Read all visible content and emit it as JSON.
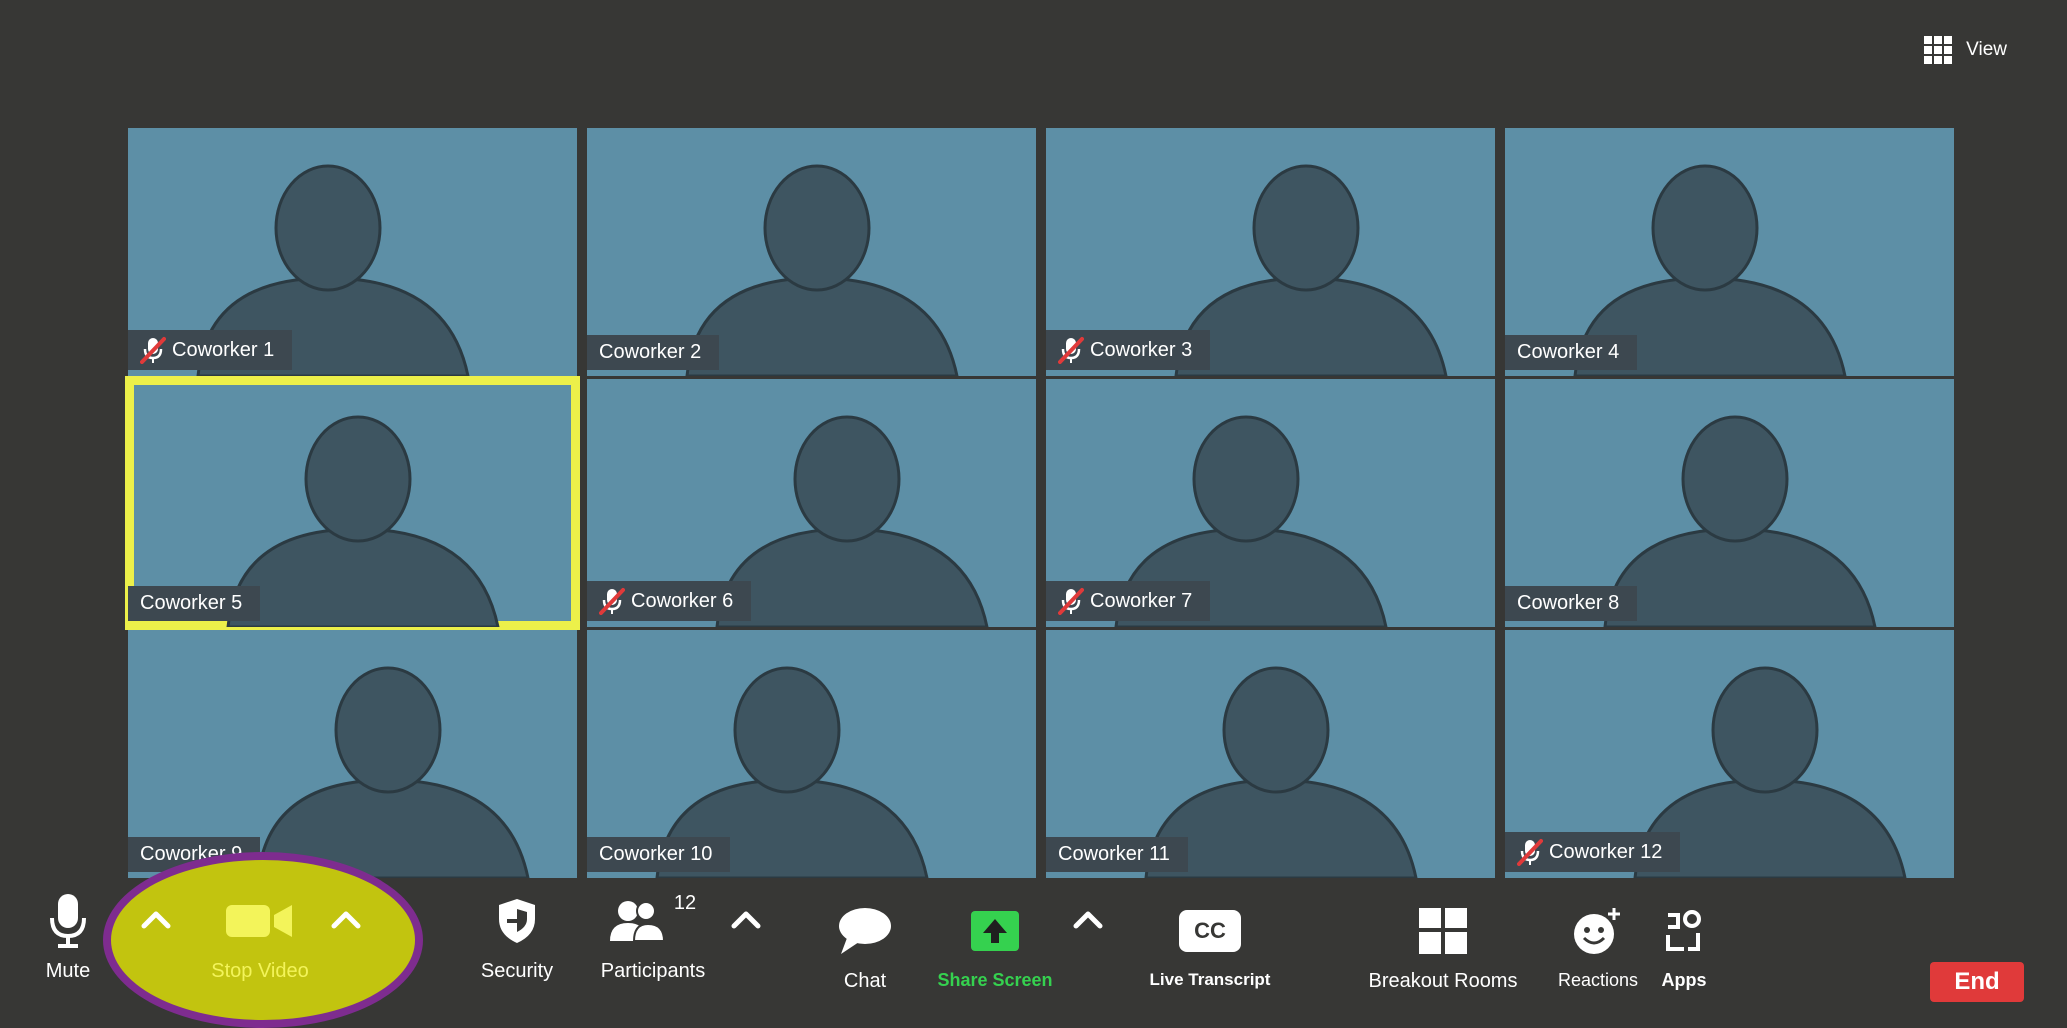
{
  "header": {
    "view_label": "View"
  },
  "participants": [
    {
      "name": "Coworker 1",
      "muted": true
    },
    {
      "name": "Coworker 2",
      "muted": false
    },
    {
      "name": "Coworker 3",
      "muted": true
    },
    {
      "name": "Coworker 4",
      "muted": false
    },
    {
      "name": "Coworker 5",
      "muted": false,
      "active_speaker": true
    },
    {
      "name": "Coworker 6",
      "muted": true
    },
    {
      "name": "Coworker 7",
      "muted": true
    },
    {
      "name": "Coworker 8",
      "muted": false
    },
    {
      "name": "Coworker 9",
      "muted": false
    },
    {
      "name": "Coworker 10",
      "muted": false
    },
    {
      "name": "Coworker 11",
      "muted": false
    },
    {
      "name": "Coworker 12",
      "muted": true
    }
  ],
  "toolbar": {
    "mute_label": "Mute",
    "video_label": "Stop Video",
    "security_label": "Security",
    "participants_label": "Participants",
    "participants_count": "12",
    "chat_label": "Chat",
    "share_label": "Share Screen",
    "transcript_label": "Live Transcript",
    "transcript_icon_text": "CC",
    "breakout_label": "Breakout Rooms",
    "reactions_label": "Reactions",
    "apps_label": "Apps",
    "end_label": "End"
  },
  "colors": {
    "background": "#373735",
    "tile": "#5d8fa6",
    "active_highlight": "#ecf04a",
    "video_highlight": "#c2c40f",
    "highlight_ring": "#7e2c8f",
    "share_green": "#35d14f",
    "end_red": "#e03a3a"
  }
}
